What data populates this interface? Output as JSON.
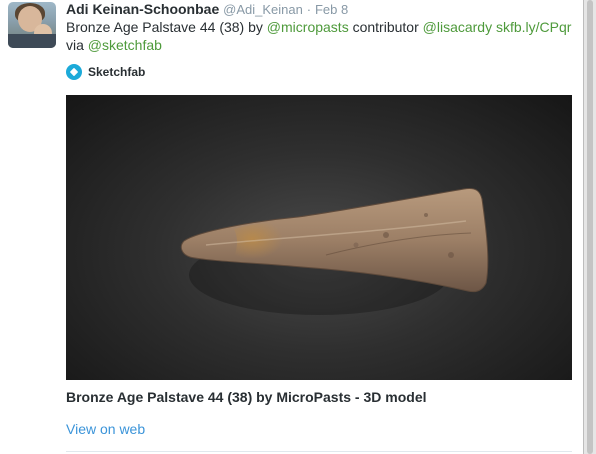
{
  "tweet": {
    "author_name": "Adi Keinan-Schoonbae",
    "author_handle": "@Adi_Keinan",
    "separator": "·",
    "time": "Feb 8",
    "text": {
      "part1": "Bronze Age Palstave 44 (38) by ",
      "mention1": "@micropasts",
      "part2": " contributor ",
      "mention2": "@lisacardy",
      "part3": " ",
      "link": "skfb.ly/CPqr",
      "part4": "via ",
      "mention3": "@sketchfab"
    }
  },
  "card": {
    "source_name": "Sketchfab",
    "source_icon": "sketchfab-logo-icon",
    "title": "Bronze Age Palstave 44 (38) by MicroPasts - 3D model",
    "view_link": "View on web"
  },
  "colors": {
    "link": "#3b94d9",
    "mention": "#4e9a3b",
    "sketchfab_brand": "#1caad9"
  }
}
